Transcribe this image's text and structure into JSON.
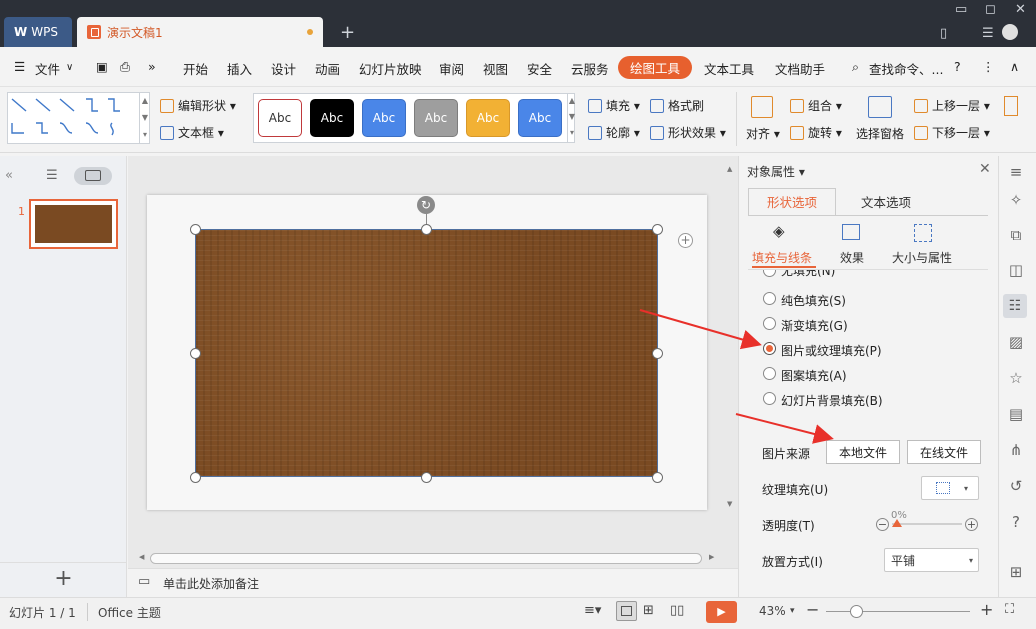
{
  "titlebar": {
    "wps_tab": "WPS",
    "doc_tab": "演示文稿1",
    "add_tab": "+"
  },
  "menu": {
    "file": "文件",
    "items": [
      "开始",
      "插入",
      "设计",
      "动画",
      "幻灯片放映",
      "审阅",
      "视图",
      "安全",
      "云服务",
      "绘图工具",
      "文本工具",
      "文档助手"
    ],
    "active": "绘图工具",
    "search": "查找命令、...",
    "help": "?"
  },
  "ribbon": {
    "edit_shape": "编辑形状",
    "text_box": "文本框",
    "style_samples": [
      {
        "label": "Abc",
        "bg": "#ffffff",
        "fg": "#333333",
        "border": "#c0393b"
      },
      {
        "label": "Abc",
        "bg": "#000000",
        "fg": "#ffffff",
        "border": "#000000"
      },
      {
        "label": "Abc",
        "bg": "#4a86e8",
        "fg": "#ffffff",
        "border": "#3a6fc6"
      },
      {
        "label": "Abc",
        "bg": "#9e9e9e",
        "fg": "#ffffff",
        "border": "#7d7d7d"
      },
      {
        "label": "Abc",
        "bg": "#f2b134",
        "fg": "#ffffff",
        "border": "#d8982a"
      },
      {
        "label": "Abc",
        "bg": "#4a86e8",
        "fg": "#ffffff",
        "border": "#3a6fc6"
      }
    ],
    "fill": "填充",
    "format_brush": "格式刷",
    "outline": "轮廓",
    "shape_effect": "形状效果",
    "align": "对齐",
    "group": "组合",
    "rotate": "旋转",
    "selection_pane": "选择窗格",
    "bring_forward": "上移一层",
    "send_backward": "下移一层"
  },
  "slides": {
    "number": "1"
  },
  "notes": {
    "placeholder": "单击此处添加备注"
  },
  "panel": {
    "title": "对象属性",
    "tabs": [
      "形状选项",
      "文本选项"
    ],
    "subtabs": [
      "填充与线条",
      "效果",
      "大小与属性"
    ],
    "fill_options": [
      {
        "label": "无填充(N)",
        "selected": false
      },
      {
        "label": "纯色填充(S)",
        "selected": false
      },
      {
        "label": "渐变填充(G)",
        "selected": false
      },
      {
        "label": "图片或纹理填充(P)",
        "selected": true
      },
      {
        "label": "图案填充(A)",
        "selected": false
      },
      {
        "label": "幻灯片背景填充(B)",
        "selected": false
      }
    ],
    "picture_source_label": "图片来源",
    "local_file": "本地文件",
    "online_file": "在线文件",
    "texture_fill_label": "纹理填充(U)",
    "transparency_label": "透明度(T)",
    "transparency_value": "0%",
    "placement_label": "放置方式(I)",
    "placement_value": "平铺"
  },
  "status": {
    "slide_info": "幻灯片 1 / 1",
    "theme": "Office 主题",
    "zoom": "43%"
  },
  "colors": {
    "accent": "#e7602e",
    "wood": "#7a4a22",
    "selection": "#4f6f9e"
  }
}
